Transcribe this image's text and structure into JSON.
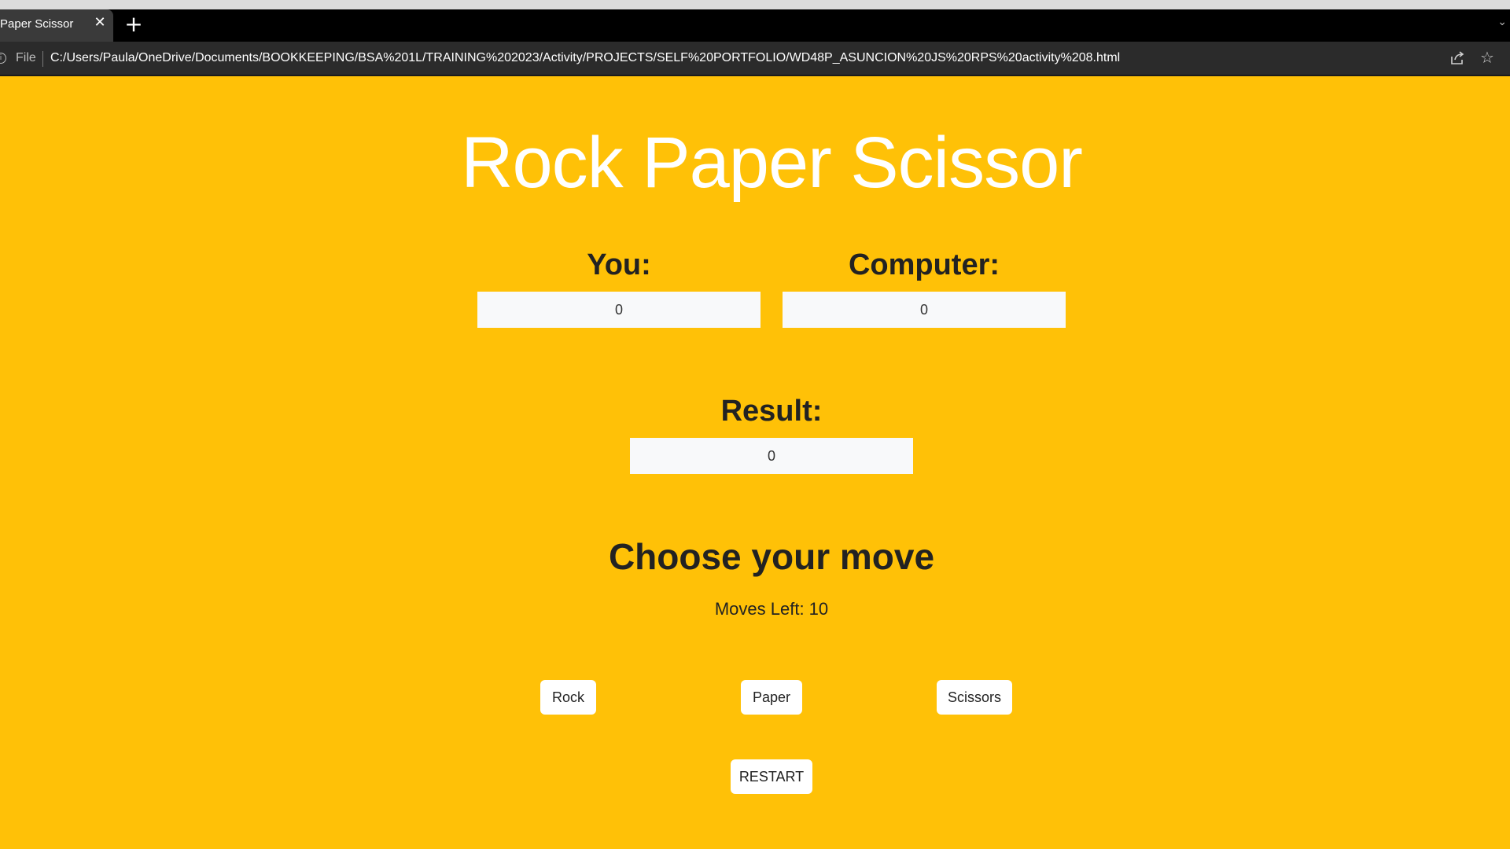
{
  "browser": {
    "tab_title": "Paper Scissor",
    "tab_close_glyph": "✕",
    "new_tab_glyph": "+",
    "file_label": "File",
    "url": "C:/Users/Paula/OneDrive/Documents/BOOKKEEPING/BSA%201L/TRAINING%202023/Activity/PROJECTS/SELF%20PORTFOLIO/WD48P_ASUNCION%20JS%20RPS%20activity%208.html",
    "icons": {
      "info": "info-icon",
      "share": "share-icon",
      "bookmark": "star-icon"
    }
  },
  "game": {
    "title": "Rock Paper Scissor",
    "you_label": "You:",
    "you_score": "0",
    "computer_label": "Computer:",
    "computer_score": "0",
    "result_label": "Result:",
    "result_value": "0",
    "choose_heading": "Choose your move",
    "moves_left": "Moves Left: 10",
    "buttons": {
      "rock": "Rock",
      "paper": "Paper",
      "scissors": "Scissors",
      "restart": "RESTART"
    }
  },
  "colors": {
    "page_background": "#ffc107",
    "title": "#ffffff",
    "text": "#222222",
    "box_background": "#f8f9fa"
  }
}
